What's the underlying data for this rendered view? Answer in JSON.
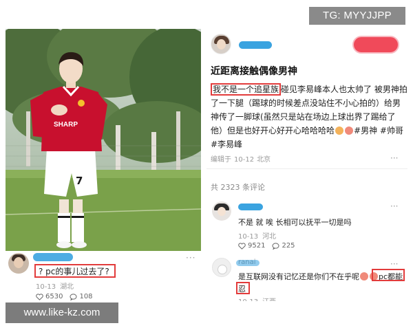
{
  "watermarks": {
    "telegram": "TG: MYYJJPP",
    "site": "www.like-kz.com"
  },
  "left_post": {
    "photo_subject": "man in red jersey",
    "jersey_sponsor": "SHARP",
    "shorts_number": "7",
    "comment": {
      "text": "? pc的事儿过去了?",
      "date": "10-13",
      "location": "湖北",
      "likes": "6530",
      "replies": "108",
      "more": "···"
    }
  },
  "right_post": {
    "title": "近距离接触偶像男神",
    "body": {
      "highlighted": "我不是一个追星族",
      "text": "碰见李易峰本人也太帅了 被男神拍了一下腿（踢球的时候差点没站住不小心拍的）给男神传了一脚球(虽然只是站在场边上球出界了踢给了他）但是也好开心好开心哈哈哈哈",
      "tags": "#男神 #帅哥 #李易峰"
    },
    "edit_info": {
      "label": "编辑于",
      "date": "10-12",
      "location": "北京"
    },
    "more": "···",
    "comment_count": "共 2323 条评论",
    "comments": [
      {
        "text": "不是 就 唉 长相可以抚平一切是吗",
        "date": "10-13",
        "location": "河北",
        "likes": "9521",
        "replies": "225",
        "more": "···"
      },
      {
        "username": "ranai",
        "text": "是互联网没有记忆还是你们不在乎呢",
        "highlight_1": "pc都能",
        "highlight_2": "忍",
        "date": "10-13",
        "location": "江西",
        "more": "···"
      }
    ]
  },
  "colors": {
    "highlight_box": "#e23b3b",
    "username_blur": "#3aa3e0",
    "follow_button": "#f04a5a",
    "jersey_red": "#c8102e"
  }
}
